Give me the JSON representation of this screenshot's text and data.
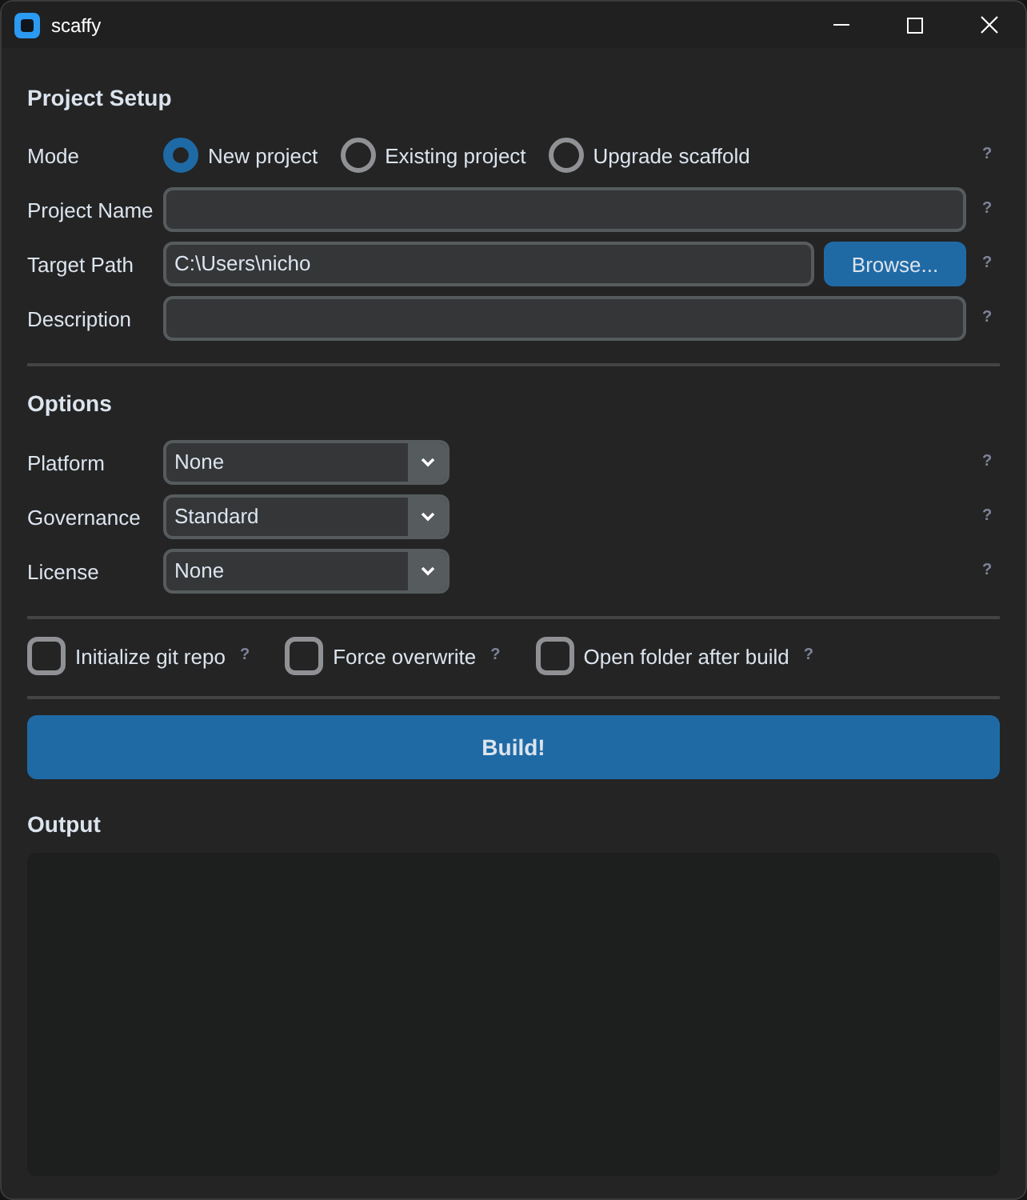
{
  "window": {
    "title": "scaffy"
  },
  "project_setup": {
    "heading": "Project Setup",
    "rows": [
      {
        "kind": "radio",
        "label": "Mode",
        "options": [
          {
            "label": "New project",
            "selected": true
          },
          {
            "label": "Existing project",
            "selected": false
          },
          {
            "label": "Upgrade scaffold",
            "selected": false
          }
        ],
        "help": "?"
      },
      {
        "kind": "entry",
        "label": "Project Name",
        "help": "?"
      },
      {
        "kind": "entry",
        "label": "Target Path",
        "value": "C:\\Users\\nicho",
        "button": "Browse...",
        "help": "?"
      },
      {
        "kind": "entry",
        "label": "Description",
        "help": "?"
      }
    ]
  },
  "options": {
    "heading": "Options",
    "rows": [
      {
        "kind": "dropdown",
        "label": "Platform",
        "value": "None",
        "help": "?"
      },
      {
        "kind": "dropdown",
        "label": "Governance",
        "value": "Standard",
        "help": "?"
      },
      {
        "kind": "dropdown",
        "label": "License",
        "value": "None",
        "help": "?"
      }
    ]
  },
  "checkboxes": [
    {
      "label": "Initialize git repo",
      "checked": false,
      "help": "?"
    },
    {
      "label": "Force overwrite",
      "checked": false,
      "help": "?"
    },
    {
      "label": "Open folder after build",
      "checked": false,
      "help": "?"
    }
  ],
  "build_button": {
    "label": "Build!"
  },
  "output": {
    "heading": "Output"
  }
}
